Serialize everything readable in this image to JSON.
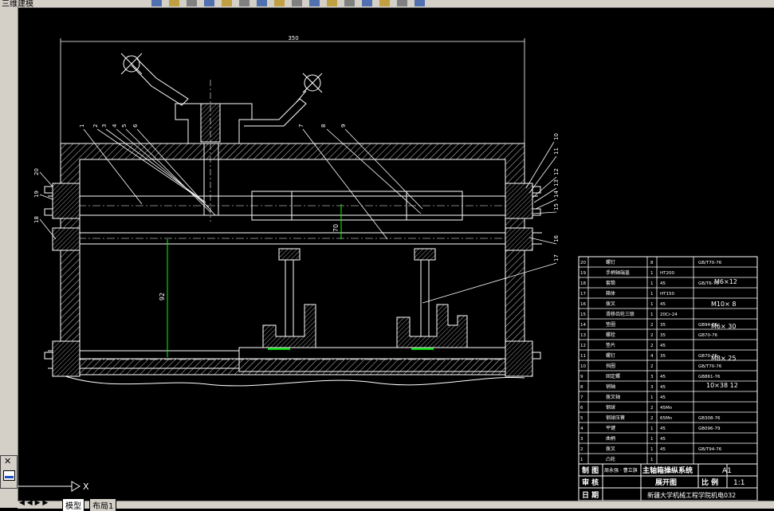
{
  "window": {
    "title_fragment": "三维建模"
  },
  "toolbar": {
    "icons": [
      "new-icon",
      "open-icon",
      "save-icon",
      "print-icon",
      "cut-icon",
      "copy-icon",
      "paste-icon",
      "undo-icon",
      "redo-icon",
      "pan-icon",
      "zoom-realtime-icon",
      "zoom-window-icon",
      "zoom-previous-icon",
      "text-icon",
      "properties-icon",
      "layer-icon"
    ]
  },
  "dimensions": {
    "overall": "350",
    "gap": "70",
    "height": "92"
  },
  "callouts": [
    "1",
    "2",
    "3",
    "4",
    "5",
    "6",
    "7",
    "8",
    "9",
    "10",
    "11",
    "12",
    "13",
    "14",
    "15",
    "16",
    "17",
    "18",
    "19",
    "20"
  ],
  "side_fits": {
    "m10x8": "M10×\n8",
    "m6x30": "M6×\n30",
    "m8x25": "M8×\n25",
    "sub10x38": "10×38\n12",
    "m6x12": "M6×12"
  },
  "parts_list": {
    "rows": [
      {
        "no": "20",
        "name": "螺钉",
        "qty": "8",
        "mat": "",
        "std": "GB/T70-76"
      },
      {
        "no": "19",
        "name": "手柄轴端盖",
        "qty": "1",
        "mat": "HT200",
        "std": ""
      },
      {
        "no": "18",
        "name": "套筒",
        "qty": "1",
        "mat": "45",
        "std": "GB/T6-76"
      },
      {
        "no": "17",
        "name": "箱体",
        "qty": "1",
        "mat": "HT150",
        "std": ""
      },
      {
        "no": "16",
        "name": "拨叉",
        "qty": "1",
        "mat": "45",
        "std": ""
      },
      {
        "no": "15",
        "name": "滑移齿轮三联",
        "qty": "1",
        "mat": "20Cr-24",
        "std": ""
      },
      {
        "no": "14",
        "name": "垫圈",
        "qty": "2",
        "mat": "35",
        "std": "GB94-76"
      },
      {
        "no": "13",
        "name": "螺栓",
        "qty": "2",
        "mat": "35",
        "std": "GB70-76"
      },
      {
        "no": "12",
        "name": "垫片",
        "qty": "2",
        "mat": "45",
        "std": ""
      },
      {
        "no": "11",
        "name": "螺钉",
        "qty": "4",
        "mat": "35",
        "std": "GB70-76"
      },
      {
        "no": "10",
        "name": "挡圈",
        "qty": "2",
        "mat": "",
        "std": "GB/T70-76"
      },
      {
        "no": "9",
        "name": "固定螺",
        "qty": "3",
        "mat": "45",
        "std": "GB861-76"
      },
      {
        "no": "8",
        "name": "销轴",
        "qty": "3",
        "mat": "45",
        "std": ""
      },
      {
        "no": "7",
        "name": "拨叉轴",
        "qty": "1",
        "mat": "45",
        "std": ""
      },
      {
        "no": "6",
        "name": "钢球",
        "qty": "2",
        "mat": "45Mn",
        "std": ""
      },
      {
        "no": "5",
        "name": "钢球压簧",
        "qty": "2",
        "mat": "65Mn",
        "std": "GB308-76"
      },
      {
        "no": "4",
        "name": "平键",
        "qty": "1",
        "mat": "45",
        "std": "GB096-79"
      },
      {
        "no": "3",
        "name": "曲柄",
        "qty": "1",
        "mat": "45",
        "std": ""
      },
      {
        "no": "2",
        "name": "拨叉",
        "qty": "1",
        "mat": "45",
        "std": "GB/T94-76"
      },
      {
        "no": "1",
        "name": "凸轮",
        "qty": "1",
        "mat": "",
        "std": ""
      }
    ]
  },
  "title_block": {
    "draw_label": "制 图",
    "draw_person": "周永强 · 曹立旗",
    "title": "主轴箱操纵系统",
    "sheet_size": "A1",
    "check_label": "审 核",
    "subtitle": "展开图",
    "scale_label": "比 例",
    "scale": "1:1",
    "date_label": "日 期",
    "school": "新疆大学机械工程学院机电032"
  },
  "ucs": {
    "x": "X",
    "y": "Y"
  },
  "tabs": {
    "nav": "◀ ◀ ▶ ▶",
    "model": "模型",
    "layout": "布局1"
  }
}
